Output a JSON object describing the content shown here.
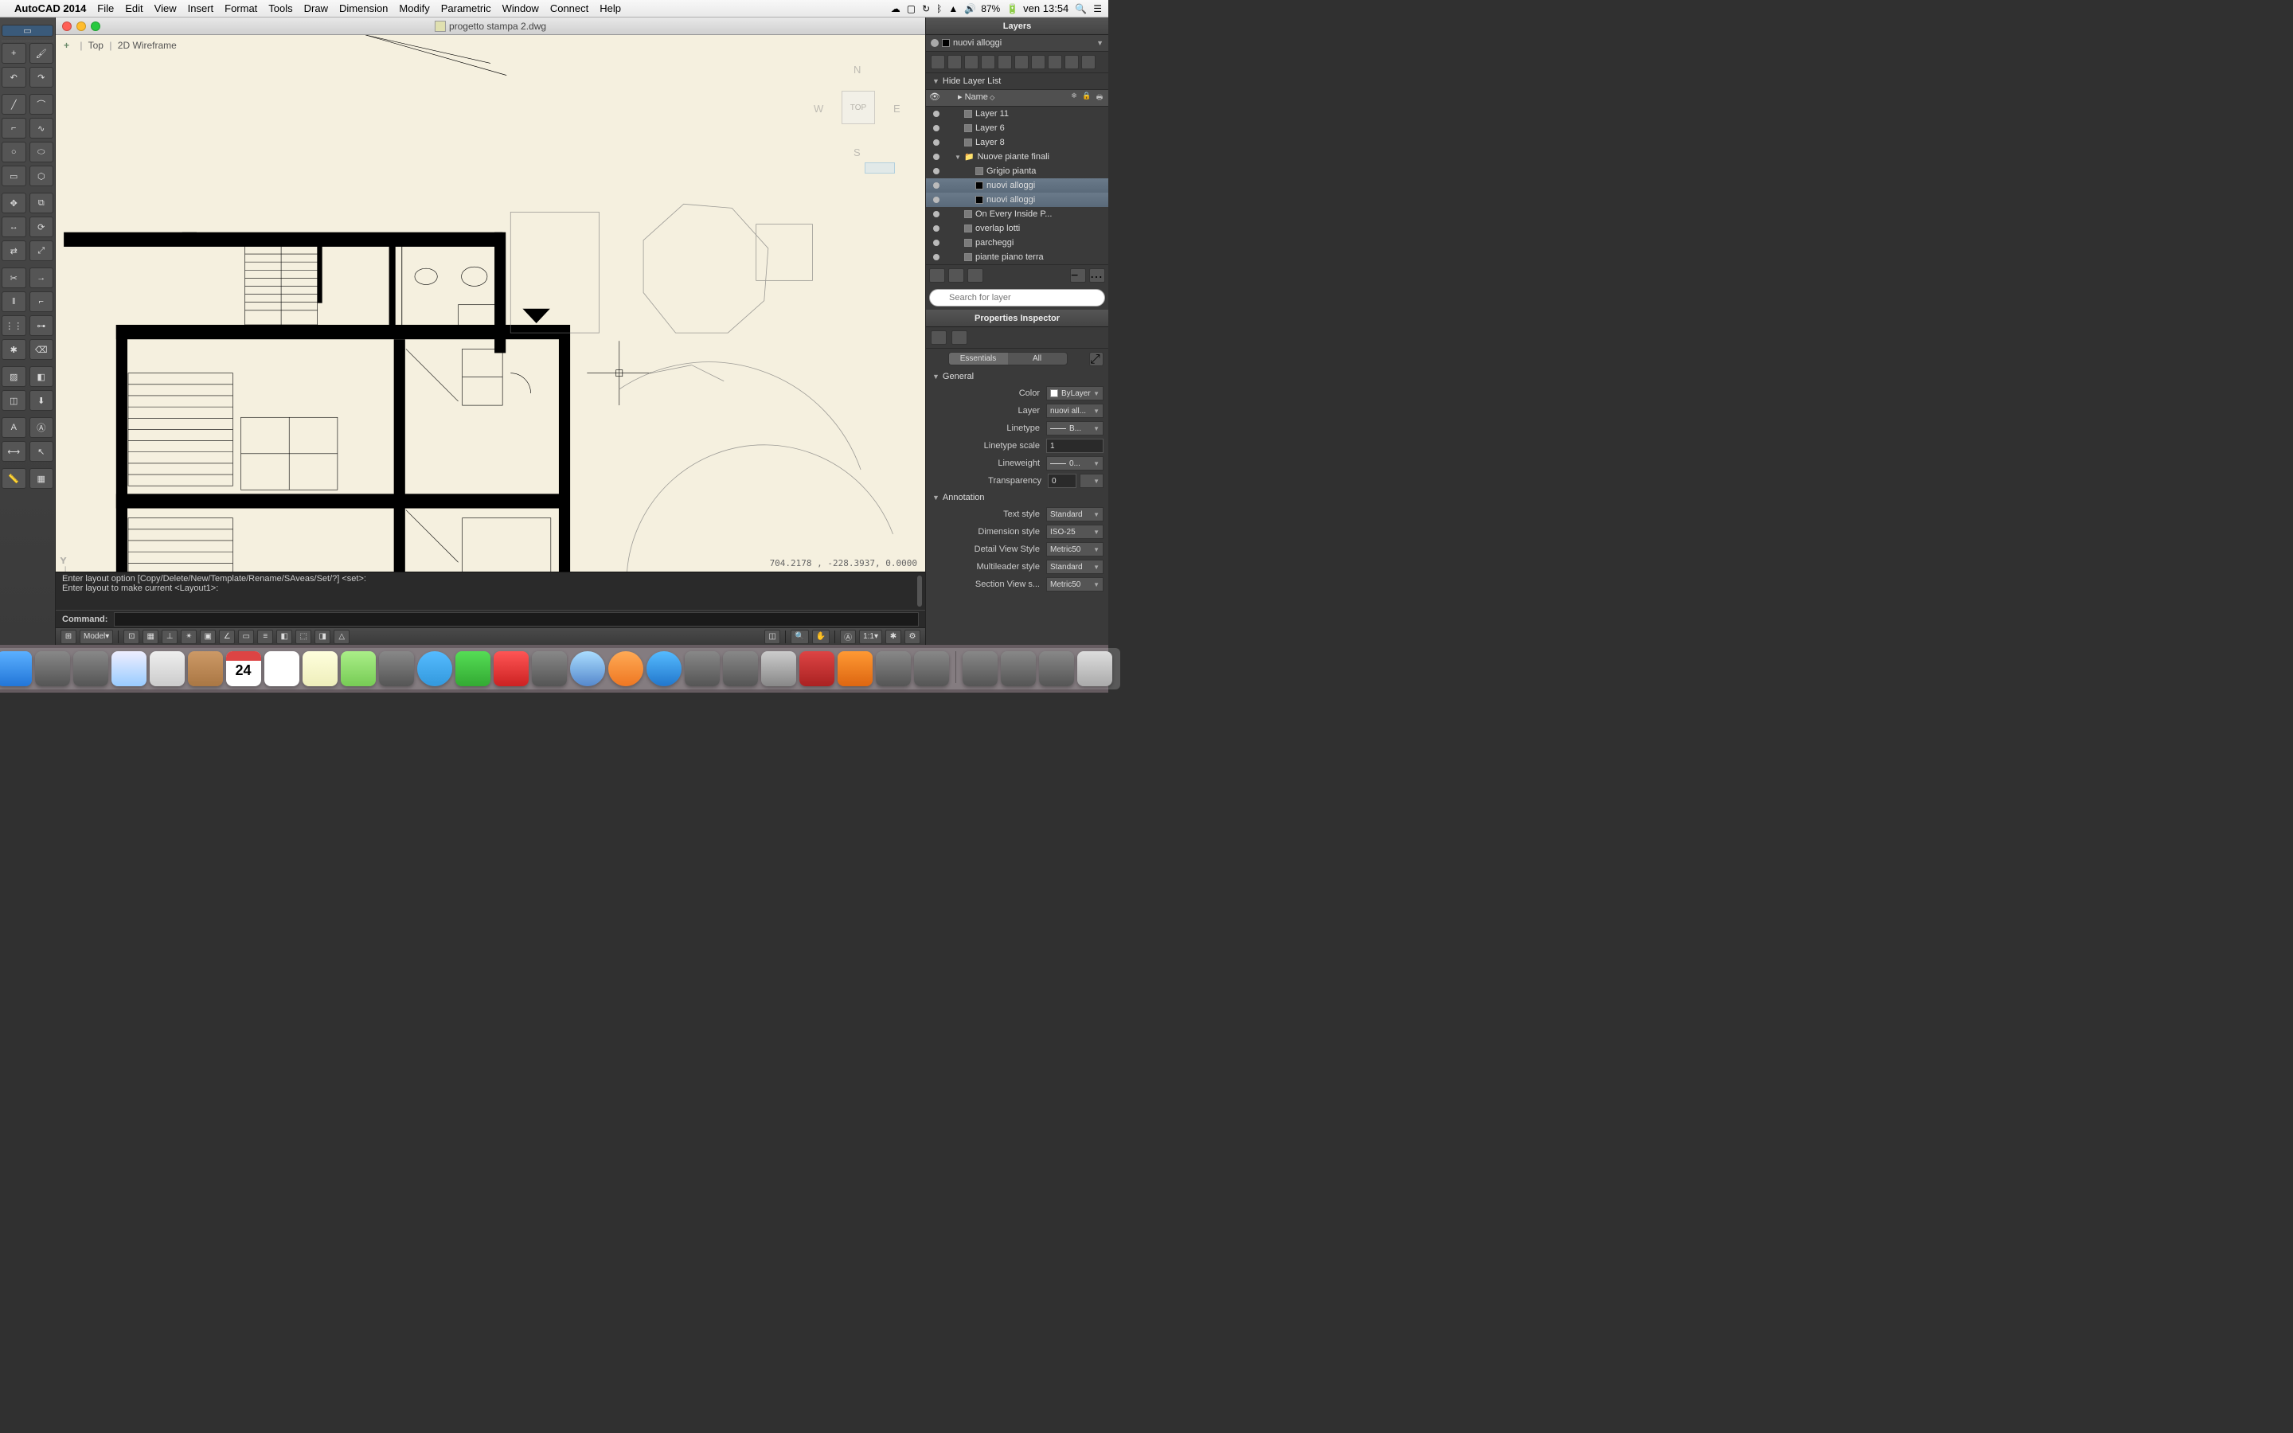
{
  "menubar": {
    "app": "AutoCAD 2014",
    "items": [
      "File",
      "Edit",
      "View",
      "Insert",
      "Format",
      "Tools",
      "Draw",
      "Dimension",
      "Modify",
      "Parametric",
      "Window",
      "Connect",
      "Help"
    ],
    "battery": "87%",
    "time": "ven 13:54"
  },
  "document": {
    "title": "progetto stampa 2.dwg"
  },
  "viewport": {
    "viewlabel_top": "Top",
    "viewlabel_style": "2D Wireframe",
    "viewcube_face": "TOP",
    "compass": {
      "n": "N",
      "s": "S",
      "e": "E",
      "w": "W"
    },
    "coords": "704.2178 , -228.3937, 0.0000"
  },
  "command": {
    "history": [
      "Enter layout option [Copy/Delete/New/Template/Rename/SAveas/Set/?] <set>:",
      "Enter layout to make current <Layout1>:"
    ],
    "prompt": "Command:"
  },
  "statusbar": {
    "model": "Model",
    "scale": "1:1"
  },
  "layers": {
    "panel_title": "Layers",
    "current_layer": "nuovi alloggi",
    "hide_label": "Hide Layer List",
    "header_name": "Name",
    "search_placeholder": "Search for layer",
    "rows": [
      {
        "name": "Layer 11",
        "indent": 1,
        "color": "#7a7a7a"
      },
      {
        "name": "Layer 6",
        "indent": 1,
        "color": "#7a7a7a"
      },
      {
        "name": "Layer 8",
        "indent": 1,
        "color": "#7a7a7a"
      },
      {
        "name": "Nuove piante finali",
        "indent": 1,
        "folder": true
      },
      {
        "name": "Grigio pianta",
        "indent": 2,
        "color": "#777777"
      },
      {
        "name": "nuovi alloggi",
        "indent": 2,
        "color": "#000000",
        "sel": true
      },
      {
        "name": "nuovi alloggi",
        "indent": 2,
        "color": "#000000",
        "sel": true
      },
      {
        "name": "On Every Inside P...",
        "indent": 1,
        "color": "#7a7a7a"
      },
      {
        "name": "overlap lotti",
        "indent": 1,
        "color": "#7a7a7a"
      },
      {
        "name": "parcheggi",
        "indent": 1,
        "color": "#7a7a7a"
      },
      {
        "name": "piante piano terra",
        "indent": 1,
        "color": "#7a7a7a"
      }
    ]
  },
  "properties": {
    "panel_title": "Properties Inspector",
    "tabs": {
      "essentials": "Essentials",
      "all": "All"
    },
    "sections": {
      "general": {
        "title": "General",
        "color": {
          "label": "Color",
          "value": "ByLayer"
        },
        "layer": {
          "label": "Layer",
          "value": "nuovi all..."
        },
        "linetype": {
          "label": "Linetype",
          "value": "B..."
        },
        "linetype_scale": {
          "label": "Linetype scale",
          "value": "1"
        },
        "lineweight": {
          "label": "Lineweight",
          "value": "0..."
        },
        "transparency": {
          "label": "Transparency",
          "value": "0"
        }
      },
      "annotation": {
        "title": "Annotation",
        "text_style": {
          "label": "Text style",
          "value": "Standard"
        },
        "dim_style": {
          "label": "Dimension style",
          "value": "ISO-25"
        },
        "detail_style": {
          "label": "Detail View Style",
          "value": "Metric50"
        },
        "mleader_style": {
          "label": "Multileader style",
          "value": "Standard"
        },
        "section_style": {
          "label": "Section View s...",
          "value": "Metric50"
        }
      }
    }
  },
  "dock": {
    "calendar_day": "24"
  }
}
